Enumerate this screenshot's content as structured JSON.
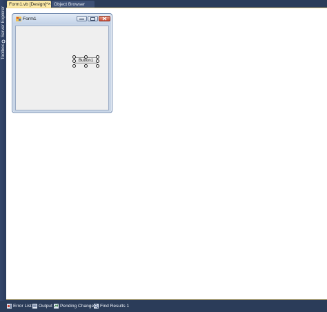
{
  "tabs": {
    "active": {
      "label": "Form1.vb [Design]*",
      "close": "×"
    },
    "inactive": {
      "label": "Object Browser"
    }
  },
  "left_rail": {
    "items": [
      {
        "label": "Server Explorer",
        "icon": "server-explorer-icon"
      },
      {
        "label": "Toolbox",
        "icon": "toolbox-icon"
      }
    ]
  },
  "designer": {
    "form_title": "Form1",
    "form_icon": "form-icon",
    "button_label": "Button1"
  },
  "bottom_tabs": [
    {
      "label": "Error List",
      "icon": "error-list-icon"
    },
    {
      "label": "Output",
      "icon": "output-icon"
    },
    {
      "label": "Pending Changes",
      "icon": "pending-changes-icon"
    },
    {
      "label": "Find Results 1",
      "icon": "find-results-icon"
    }
  ],
  "colors": {
    "chrome": "#2b3c59",
    "active_tab": "#fbe9a6",
    "surface": "#ffffff"
  }
}
